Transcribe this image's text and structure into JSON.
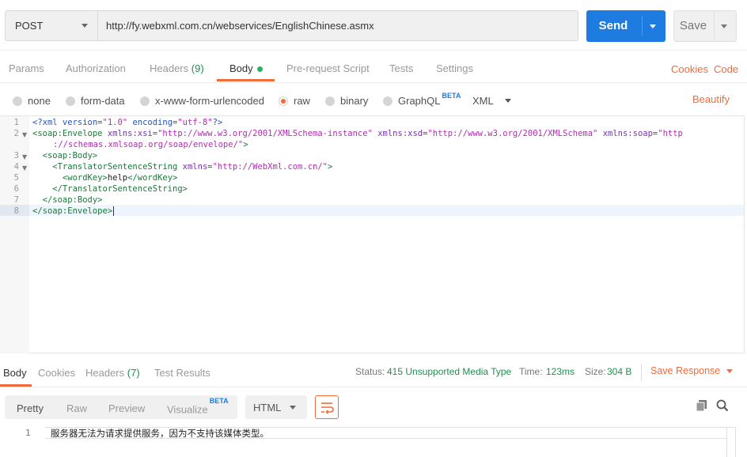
{
  "request": {
    "method": "POST",
    "url": "http://fy.webxml.com.cn/webservices/EnglishChinese.asmx",
    "send_label": "Send",
    "save_label": "Save"
  },
  "tabs": [
    {
      "label": "Params"
    },
    {
      "label": "Authorization"
    },
    {
      "label": "Headers",
      "count": "(9)"
    },
    {
      "label": "Body"
    },
    {
      "label": "Pre-request Script"
    },
    {
      "label": "Tests"
    },
    {
      "label": "Settings"
    }
  ],
  "tab_links": {
    "cookies": "Cookies",
    "code": "Code"
  },
  "body_types": [
    {
      "label": "none",
      "selected": false
    },
    {
      "label": "form-data",
      "selected": false
    },
    {
      "label": "x-www-form-urlencoded",
      "selected": false
    },
    {
      "label": "raw",
      "selected": true
    },
    {
      "label": "binary",
      "selected": false
    },
    {
      "label": "GraphQL",
      "selected": false,
      "badge": "BETA"
    }
  ],
  "raw_format": "XML",
  "beautify_label": "Beautify",
  "editor": {
    "line_numbers": [
      "1",
      "2",
      "",
      "3",
      "4",
      "5",
      "6",
      "7",
      "8"
    ],
    "active_line": "8"
  },
  "response_tabs": [
    {
      "label": "Body"
    },
    {
      "label": "Cookies"
    },
    {
      "label": "Headers",
      "count": "(7)"
    },
    {
      "label": "Test Results"
    }
  ],
  "response_meta": {
    "status_label": "Status:",
    "status_value": "415 Unsupported Media Type",
    "time_label": "Time:",
    "time_value": "123ms",
    "size_label": "Size:",
    "size_value": "304 B",
    "save_response": "Save Response"
  },
  "response_formats": [
    {
      "label": "Pretty"
    },
    {
      "label": "Raw"
    },
    {
      "label": "Preview"
    },
    {
      "label": "Visualize",
      "badge": "BETA"
    }
  ],
  "response_language": "HTML",
  "response_body": {
    "line_number": "1",
    "text": "服务器无法为请求提供服务，因为不支持该媒体类型。"
  },
  "colors": {
    "accent": "#f26b3a",
    "send": "#1e7be0",
    "status_ok_text": "#1f8f4f"
  }
}
